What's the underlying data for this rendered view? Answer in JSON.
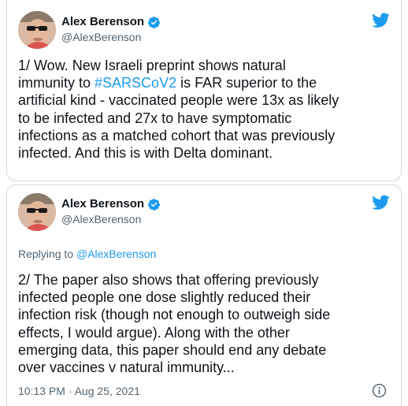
{
  "tweets": [
    {
      "author": {
        "display_name": "Alex Berenson",
        "handle": "@AlexBerenson"
      },
      "text_before": "1/ Wow. New Israeli preprint shows natural\nimmunity to ",
      "hashtag": "#SARSCoV2",
      "text_after": " is FAR superior to the\nartificial kind - vaccinated people were 13x as likely\nto be infected and 27x to have symptomatic\ninfections as a matched cohort that was previously\ninfected. And this is with Delta dominant."
    },
    {
      "author": {
        "display_name": "Alex Berenson",
        "handle": "@AlexBerenson"
      },
      "replying_prefix": "Replying to ",
      "replying_to": "@AlexBerenson",
      "text": "2/ The paper also shows that offering previously\ninfected people one dose slightly reduced their\ninfection risk (though not enough to outweigh side\neffects, I would argue). Along with the other\nemerging data, this paper should end any debate\nover vaccines v natural immunity...",
      "timestamp": "10:13 PM · Aug 25, 2021"
    }
  ],
  "icons": {
    "verified": "verified-badge-icon",
    "brand": "twitter-bird-icon",
    "info": "info-icon"
  },
  "colors": {
    "accent": "#1d9bf0",
    "muted": "#536471",
    "text": "#0f1419",
    "border": "#cfd9de"
  }
}
